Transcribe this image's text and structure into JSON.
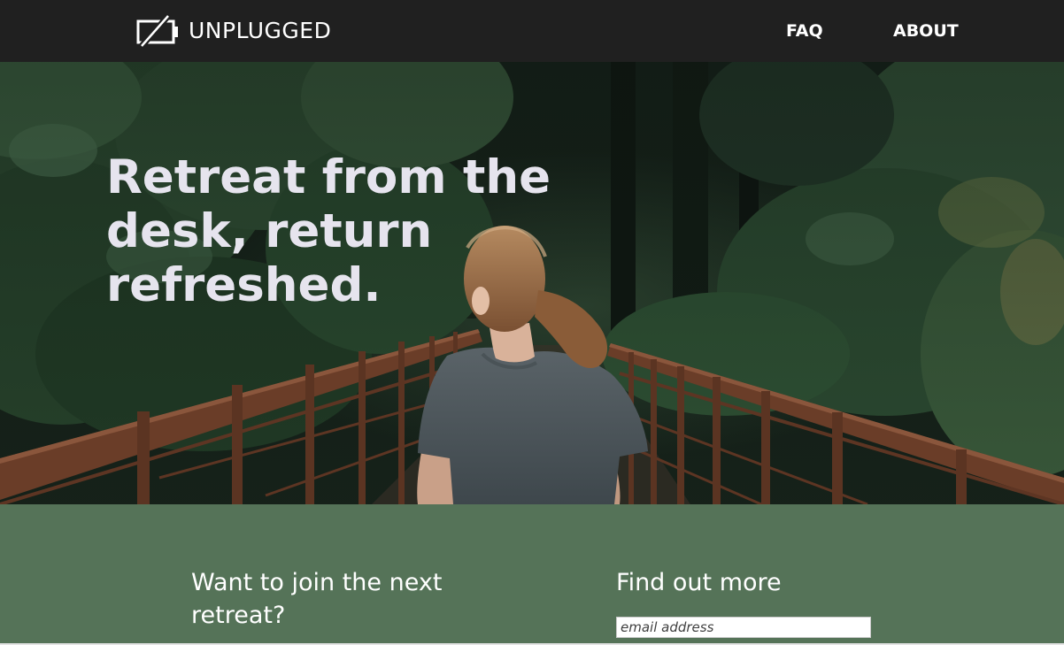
{
  "header": {
    "logo_text": "UNPLUGGED",
    "logo_icon": "battery-slash-icon",
    "nav": [
      {
        "label": "FAQ"
      },
      {
        "label": "ABOUT"
      }
    ]
  },
  "hero": {
    "headline": "Retreat from the desk, return refreshed."
  },
  "signup": {
    "cta_text": "Want to join the next retreat?",
    "heading": "Find out more",
    "email_placeholder": "email address"
  },
  "colors": {
    "header_bg": "#202020",
    "signup_bg": "#557358",
    "headline": "#e6e4ee"
  }
}
